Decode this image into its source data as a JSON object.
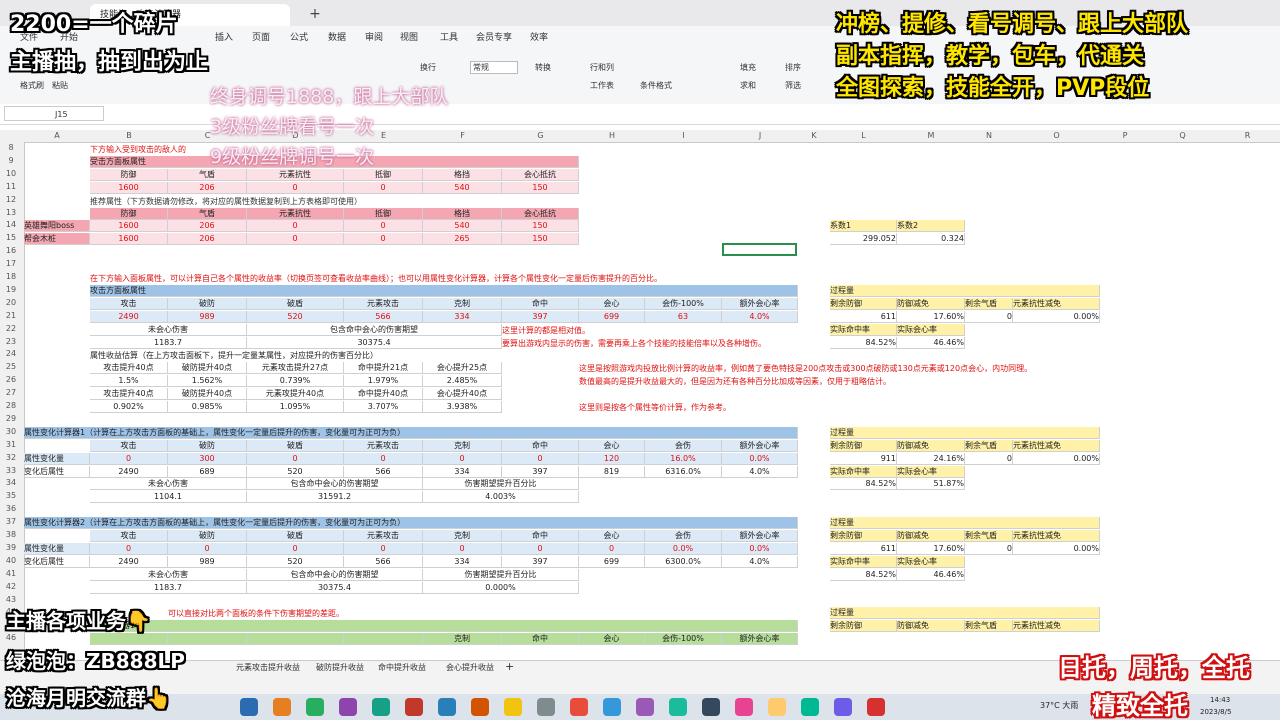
{
  "window": {
    "tab_title": "技能资…攻击计算器",
    "new_tab": "+"
  },
  "menu": [
    "文件",
    "开始",
    "插入",
    "页面",
    "公式",
    "数据",
    "审阅",
    "视图",
    "工具",
    "会员专享",
    "效率"
  ],
  "ribbon": {
    "format_painter": "格式刷",
    "paste": "粘贴",
    "wrap": "换行",
    "font_style": "常规",
    "convert": "转换",
    "row_col": "行和列",
    "worksheet": "工作表",
    "cond_format": "条件格式",
    "fill": "填充",
    "sort": "排序",
    "freeze": "冻结",
    "sum": "求和",
    "filter": "筛选",
    "find": "查找",
    "merge": "合并"
  },
  "formula_bar": {
    "cell_ref": "J15"
  },
  "columns": [
    "A",
    "B",
    "C",
    "D",
    "E",
    "F",
    "G",
    "H",
    "I",
    "J",
    "K",
    "L",
    "M",
    "N",
    "O",
    "P",
    "Q",
    "R"
  ],
  "rows": [
    "8",
    "9",
    "10",
    "11",
    "12",
    "13",
    "14",
    "15",
    "16",
    "17",
    "18",
    "19",
    "20",
    "21",
    "22",
    "23",
    "24",
    "25",
    "26",
    "27",
    "28",
    "29",
    "30",
    "31",
    "32",
    "33",
    "34",
    "35",
    "36",
    "37",
    "38",
    "39",
    "40",
    "41",
    "42",
    "43",
    "44",
    "45",
    "46"
  ],
  "sec1": {
    "instruction": "下方输入受到攻击的敌人的",
    "title": "受击方面板属性",
    "headers": [
      "防御",
      "气盾",
      "元素抗性",
      "抵御",
      "格挡",
      "会心抵抗"
    ],
    "values": [
      "1600",
      "206",
      "0",
      "0",
      "540",
      "150"
    ],
    "recommend": "推荐属性（下方数据请勿修改，将对应的属性数据复制到上方表格即可使用）",
    "rows": [
      {
        "name": "",
        "vals": [
          "防御",
          "气盾",
          "元素抗性",
          "抵御",
          "格挡",
          "会心抵抗"
        ]
      },
      {
        "name": "英雄舞阳boss",
        "vals": [
          "1600",
          "206",
          "0",
          "0",
          "540",
          "150"
        ]
      },
      {
        "name": "帮会木桩",
        "vals": [
          "1600",
          "206",
          "0",
          "0",
          "265",
          "150"
        ]
      }
    ]
  },
  "coef": {
    "labels": [
      "系数1",
      "系数2"
    ],
    "values": [
      "299.052",
      "0.324"
    ]
  },
  "sec2": {
    "instruction": "在下方输入面板属性，可以计算自己各个属性的收益率（切换页签可查看收益率曲线）；也可以用属性变化计算器，计算各个属性变化一定量后伤害提升的百分比。",
    "title": "攻击方面板属性",
    "headers": [
      "攻击",
      "破防",
      "破盾",
      "元素攻击",
      "克制",
      "命中",
      "会心",
      "会伤-100%",
      "额外会心率"
    ],
    "values": [
      "2490",
      "989",
      "520",
      "566",
      "334",
      "397",
      "699",
      "63",
      "4.0%"
    ],
    "res_headers": [
      "未会心伤害",
      "包含命中会心的伤害期望"
    ],
    "res_values": [
      "1183.7",
      "30375.4"
    ],
    "note1": "这里计算的都是相对值。",
    "note2": "要算出游戏内显示的伤害，需要再乘上各个技能的技能倍率以及各种增伤。",
    "gain_title": "属性收益估算（在上方攻击面板下，提升一定量某属性，对应提升的伤害百分比）",
    "gain_h1": [
      "攻击提升40点",
      "破防提升40点",
      "元素攻击提升27点",
      "命中提升21点",
      "会心提升25点"
    ],
    "gain_v1": [
      "1.5%",
      "1.562%",
      "0.739%",
      "1.979%",
      "2.485%"
    ],
    "gain_h2": [
      "攻击提升40点",
      "破防提升40点",
      "元素攻提升40点",
      "命中提升40点",
      "会心提升40点"
    ],
    "gain_v2": [
      "0.902%",
      "0.985%",
      "1.095%",
      "3.707%",
      "3.938%"
    ],
    "note3": "这里是按照游戏内投放比例计算的收益率，例如黄了要色特技是200点攻击或300点破防或130点元素或120点会心，内功同理。",
    "note4": "数值最高的是提升收益最大的，但是因为还有各种百分比加成等因素，仅用于粗略估计。",
    "note5": "这里则是按各个属性等价计算，作为参考。"
  },
  "proc1": {
    "title": "过程量",
    "h1": [
      "剩余防御",
      "防御减免",
      "剩余气盾",
      "元素抗性减免"
    ],
    "v1": [
      "611",
      "17.60%",
      "0",
      "0.00%"
    ],
    "h2": [
      "实际命中率",
      "实际会心率"
    ],
    "v2": [
      "84.52%",
      "46.46%"
    ]
  },
  "calc1": {
    "title": "属性变化计算器1（计算在上方攻击方面板的基础上，属性变化一定量后提升的伤害，变化量可为正可为负）",
    "headers": [
      "攻击",
      "破防",
      "破盾",
      "元素攻击",
      "克制",
      "命中",
      "会心",
      "会伤",
      "额外会心率"
    ],
    "r1_label": "属性变化量",
    "r1": [
      "0",
      "300",
      "0",
      "0",
      "0",
      "0",
      "120",
      "16.0%",
      "0.0%"
    ],
    "r2_label": "变化后属性",
    "r2": [
      "2490",
      "689",
      "520",
      "566",
      "334",
      "397",
      "819",
      "6316.0%",
      "4.0%"
    ],
    "res_headers": [
      "未会心伤害",
      "包含命中会心的伤害期望",
      "伤害期望提升百分比"
    ],
    "res_values": [
      "1104.1",
      "31591.2",
      "4.003%"
    ]
  },
  "proc2": {
    "title": "过程量",
    "h1": [
      "剩余防御",
      "防御减免",
      "剩余气盾",
      "元素抗性减免"
    ],
    "v1": [
      "911",
      "24.16%",
      "0",
      "0.00%"
    ],
    "h2": [
      "实际命中率",
      "实际会心率"
    ],
    "v2": [
      "84.52%",
      "51.87%"
    ]
  },
  "calc2": {
    "title": "属性变化计算器2（计算在上方攻击方面板的基础上，属性变化一定量后提升的伤害，变化量可为正可为负）",
    "headers": [
      "攻击",
      "破防",
      "破盾",
      "元素攻击",
      "克制",
      "命中",
      "会心",
      "会伤",
      "额外会心率"
    ],
    "r1_label": "属性变化量",
    "r1": [
      "0",
      "0",
      "0",
      "0",
      "0",
      "0",
      "0",
      "0.0%",
      "0.0%"
    ],
    "r2_label": "变化后属性",
    "r2": [
      "2490",
      "989",
      "520",
      "566",
      "334",
      "397",
      "699",
      "6300.0%",
      "4.0%"
    ],
    "res_headers": [
      "未会心伤害",
      "包含命中会心的伤害期望",
      "伤害期望提升百分比"
    ],
    "res_values": [
      "1183.7",
      "30375.4",
      "0.000%"
    ]
  },
  "proc3": {
    "title": "过程量",
    "h1": [
      "剩余防御",
      "防御减免",
      "剩余气盾",
      "元素抗性减免"
    ],
    "v1": [
      "611",
      "17.60%",
      "0",
      "0.00%"
    ],
    "h2": [
      "实际命中率",
      "实际会心率"
    ],
    "v2": [
      "84.52%",
      "46.46%"
    ]
  },
  "sec4": {
    "note": "可以直接对比两个面板的条件下伤害期望的差距。",
    "title": "面板对比器1",
    "headers": [
      "",
      "",
      "",
      "",
      "克制",
      "命中",
      "会心",
      "会伤-100%",
      "额外会心率"
    ]
  },
  "proc4": {
    "title": "过程量",
    "h1": [
      "剩余防御",
      "防御减免",
      "剩余气盾",
      "元素抗性减免"
    ]
  },
  "sheet_tabs": [
    "元素攻击提升收益",
    "破防提升收益",
    "命中提升收益",
    "会心提升收益"
  ],
  "overlays": {
    "tl1": "2200=一个碎片",
    "tl2": "主播抽，抽到出为止",
    "mid1": "终身调号1888，跟上大部队",
    "mid2": "3级粉丝牌看号一次",
    "mid3": "9级粉丝牌调号一次",
    "tr1": "冲榜、提修、看号调号、跟上大部队",
    "tr2": "副本指挥，教学，包车，代通关",
    "tr3": "全图探索，技能全开，PVP段位",
    "bl1": "主播各项业务👇",
    "bl2": "绿泡泡：ZB888LP",
    "bl3": "沧海月明交流群👆",
    "br1": "日托，周托，全托",
    "br2": "精致全托"
  },
  "taskbar": {
    "weather": "37°C 大雨",
    "time": "14:43",
    "date": "2023/8/5"
  }
}
